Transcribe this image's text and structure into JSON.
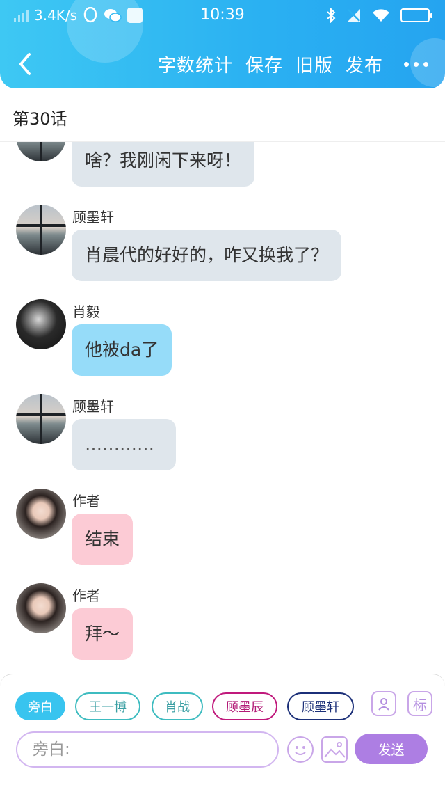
{
  "status_bar": {
    "network_speed": "3.4K/s",
    "time": "10:39",
    "left_icons": [
      "signal-icon",
      "qq-icon",
      "wechat-icon",
      "shop-icon"
    ],
    "right_icons": [
      "bluetooth-icon",
      "mobile-data-off-icon",
      "wifi-icon",
      "battery-icon"
    ]
  },
  "nav": {
    "back_icon": "chevron-left-icon",
    "actions": {
      "word_count": "字数统计",
      "save": "保存",
      "old_version": "旧版",
      "publish": "发布"
    },
    "more_icon": "more-dots-icon"
  },
  "chapter": {
    "title": "第30话"
  },
  "messages": [
    {
      "sender": "",
      "text": "啥？我刚闲下来呀！",
      "bubble_color": "#dfe6ec",
      "avatar": "silhouette-window"
    },
    {
      "sender": "顾墨轩",
      "text": "肖晨代的好好的，咋又换我了？",
      "bubble_color": "#dfe6ec",
      "avatar": "silhouette-window"
    },
    {
      "sender": "肖毅",
      "text": "他被da了",
      "bubble_color": "#96dcf9",
      "avatar": "dark-portrait"
    },
    {
      "sender": "顾墨轩",
      "text": "…………",
      "bubble_color": "#dfe6ec",
      "avatar": "silhouette-window"
    },
    {
      "sender": "作者",
      "text": "结束",
      "bubble_color": "#fccbd5",
      "avatar": "girl-portrait"
    },
    {
      "sender": "作者",
      "text": "拜～",
      "bubble_color": "#fccbd5",
      "avatar": "girl-portrait"
    }
  ],
  "roles": [
    {
      "label": "旁白",
      "active": true,
      "color": "#38c4ef"
    },
    {
      "label": "王一博",
      "active": false,
      "color": "#3ebcc0"
    },
    {
      "label": "肖战",
      "active": false,
      "color": "#3ebcc0"
    },
    {
      "label": "顾墨辰",
      "active": false,
      "color": "#c0197c"
    },
    {
      "label": "顾墨轩",
      "active": false,
      "color": "#1b2f78"
    }
  ],
  "tools": {
    "role_manage_icon": "person-card-icon",
    "tag_label": "标"
  },
  "composer": {
    "placeholder": "旁白:",
    "value": "",
    "emoji_icon": "smiley-icon",
    "image_icon": "image-icon",
    "send_label": "发送"
  },
  "colors": {
    "header_gradient_start": "#3ec8f3",
    "header_gradient_end": "#25a4f0",
    "accent_purple": "#ad7ee3"
  }
}
